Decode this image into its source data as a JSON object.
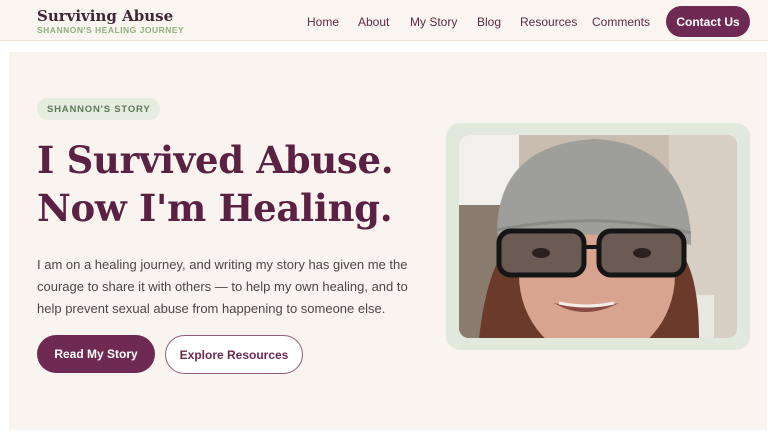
{
  "brand": {
    "title": "Surviving Abuse",
    "subtitle": "SHANNON'S HEALING JOURNEY"
  },
  "nav": {
    "items": [
      "Home",
      "About",
      "My Story",
      "Blog",
      "Resources",
      "Comments"
    ],
    "contact": "Contact Us"
  },
  "hero": {
    "badge": "SHANNON'S STORY",
    "headline_line1": "I Survived Abuse.",
    "headline_line2": "Now I'm Healing.",
    "description": "I am on a healing journey, and writing my story has given me the courage to share it with others — to help my own healing, and to help prevent sexual abuse from happening to someone else.",
    "primary_button": "Read My Story",
    "secondary_button": "Explore Resources"
  },
  "colors": {
    "brand": "#6e2a52",
    "headline": "#5b2143",
    "accent_green": "#8fb07d",
    "background": "#f9f4ef"
  }
}
